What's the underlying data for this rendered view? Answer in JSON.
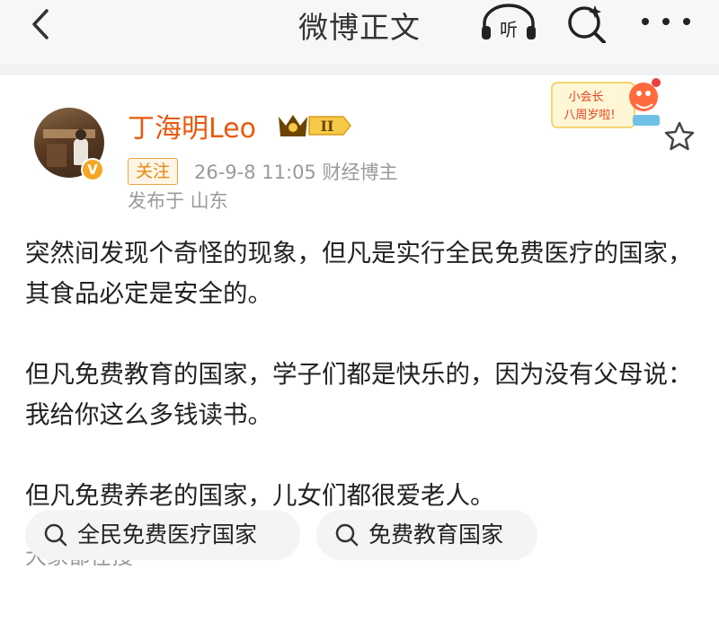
{
  "header": {
    "title": "微博正文",
    "listen_label": "听"
  },
  "post": {
    "author": "丁海明Leo",
    "level_badge": "II",
    "follow_label": "关注",
    "meta": "26-9-8 11:05   财经博主",
    "location": "发布于 山东",
    "verified_mark": "V",
    "anniversary_badge": [
      "小会长",
      "八周岁啦!"
    ],
    "paragraphs": [
      "突然间发现个奇怪的现象，但凡是实行全民免费医疗的国家，其食品必定是安全的。",
      "但凡免费教育的国家，学子们都是快乐的，因为没有父母说：我给你这么多钱读书。",
      "但凡免费养老的国家，儿女们都很爱老人。"
    ]
  },
  "hot_search": {
    "title": "大家都在搜",
    "items": [
      "全民免费医疗国家",
      "免费教育国家"
    ]
  },
  "colors": {
    "accent": "#e8590c",
    "follow": "#e8880c",
    "gray_text": "#9a9a9a"
  },
  "icons": [
    "back-icon",
    "headphones-icon",
    "search-icon",
    "more-icon",
    "star-icon",
    "crown-icon",
    "verified-icon"
  ]
}
